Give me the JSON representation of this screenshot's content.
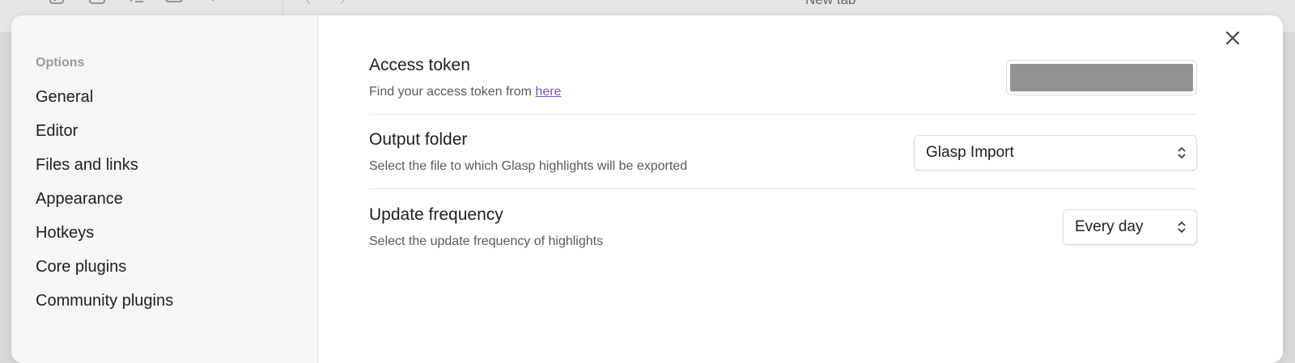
{
  "topbar": {
    "tab_title": "New tab",
    "icons": [
      "edit-icon",
      "new-file-icon",
      "list-icon",
      "panel-icon",
      "chevron-down-icon"
    ]
  },
  "sidebar": {
    "section_label": "Options",
    "items": [
      {
        "label": "General"
      },
      {
        "label": "Editor"
      },
      {
        "label": "Files and links"
      },
      {
        "label": "Appearance"
      },
      {
        "label": "Hotkeys"
      },
      {
        "label": "Core plugins"
      },
      {
        "label": "Community plugins"
      }
    ]
  },
  "settings": {
    "access_token": {
      "title": "Access token",
      "desc_prefix": "Find your access token from ",
      "link_text": "here"
    },
    "output_folder": {
      "title": "Output folder",
      "desc": "Select the file to which Glasp highlights will be exported",
      "value": "Glasp Import"
    },
    "update_frequency": {
      "title": "Update frequency",
      "desc": "Select the update frequency of highlights",
      "value": "Every day"
    }
  },
  "colors": {
    "link": "#7a4fc9",
    "sidebar_bg": "#f6f6f6",
    "redaction": "#929292"
  }
}
